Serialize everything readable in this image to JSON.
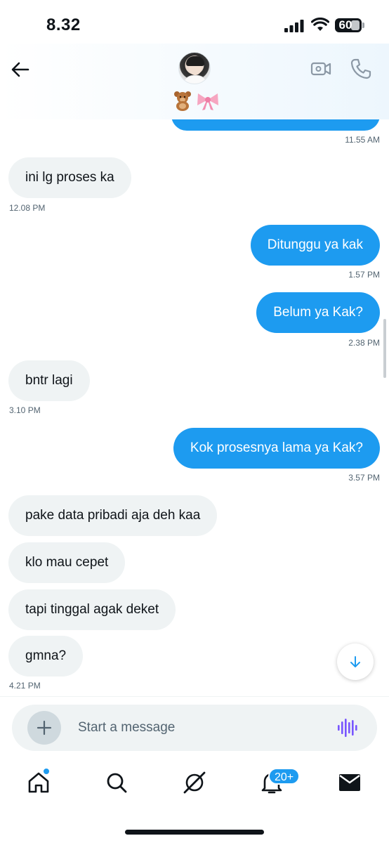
{
  "status_bar": {
    "time": "8.32",
    "battery": "60"
  },
  "header": {
    "avatar_alt": "avatar",
    "name_emoji": "🧸🎀"
  },
  "messages": [
    {
      "side": "out",
      "text": "",
      "time": "11.55 AM",
      "partial": true
    },
    {
      "side": "in",
      "text": "ini lg proses ka",
      "time": "12.08 PM"
    },
    {
      "side": "out",
      "text": "Ditunggu ya kak",
      "time": "1.57 PM"
    },
    {
      "side": "out",
      "text": "Belum ya Kak?",
      "time": "2.38 PM"
    },
    {
      "side": "in",
      "text": "bntr lagi",
      "time": "3.10 PM"
    },
    {
      "side": "out",
      "text": "Kok prosesnya lama ya Kak?",
      "time": "3.57 PM"
    },
    {
      "side": "in",
      "text": "pake data pribadi aja deh kaa",
      "time": ""
    },
    {
      "side": "in",
      "text": "klo mau cepet",
      "time": ""
    },
    {
      "side": "in",
      "text": "tapi tinggal agak deket",
      "time": ""
    },
    {
      "side": "in",
      "text": "gmna?",
      "time": "4.21 PM"
    }
  ],
  "composer": {
    "placeholder": "Start a message"
  },
  "nav": {
    "items": [
      {
        "name": "home",
        "icon": "home-icon"
      },
      {
        "name": "search",
        "icon": "search-icon"
      },
      {
        "name": "grok",
        "icon": "grok-icon"
      },
      {
        "name": "notifications",
        "icon": "bell-icon"
      },
      {
        "name": "messages",
        "icon": "envelope-icon"
      }
    ],
    "notifications_badge": "20+"
  },
  "colors": {
    "accent": "#1d9bf0",
    "incoming_bubble": "#eff3f4",
    "text": "#0f1419",
    "muted": "#536471"
  }
}
